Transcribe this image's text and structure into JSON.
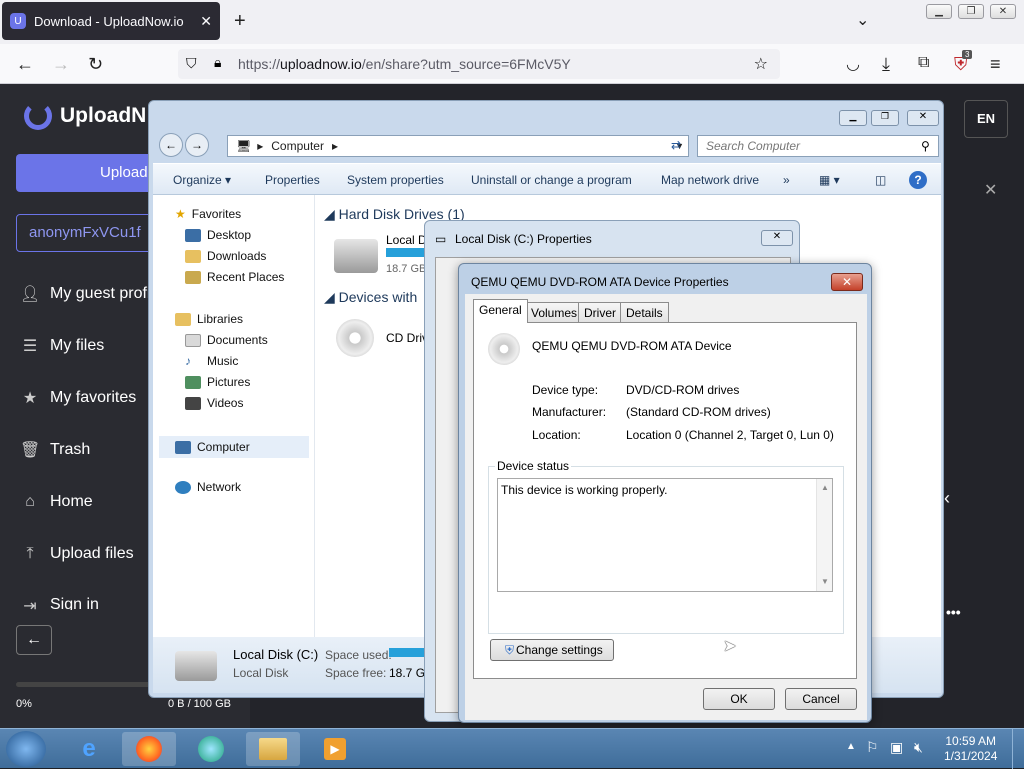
{
  "browser": {
    "tab_title": "Download - UploadNow.io",
    "url_prefix": "https://",
    "url_host": "uploadnow.io",
    "url_rest": "/en/share?utm_source=6FMcV5Y",
    "extension_badge": "3"
  },
  "site": {
    "logo_text": "UploadN",
    "upload_button": "Upload",
    "user_field": "anonymFxVCu1f",
    "nav": [
      {
        "icon": "user-icon",
        "label": "My guest profi"
      },
      {
        "icon": "list-icon",
        "label": "My files"
      },
      {
        "icon": "star-icon",
        "label": "My favorites"
      },
      {
        "icon": "trash-icon",
        "label": "Trash"
      },
      {
        "icon": "home-icon",
        "label": "Home"
      },
      {
        "icon": "upload-icon",
        "label": "Upload files"
      },
      {
        "icon": "signin-icon",
        "label": "Sign in"
      }
    ],
    "progress_percent": "0%",
    "quota": "0 B / 100 GB",
    "language": "EN"
  },
  "explorer": {
    "address": "Computer",
    "search_placeholder": "Search Computer",
    "toolbar": [
      "Organize",
      "Properties",
      "System properties",
      "Uninstall or change a program",
      "Map network drive"
    ],
    "nav": {
      "favorites": "Favorites",
      "favorites_items": [
        "Desktop",
        "Downloads",
        "Recent Places"
      ],
      "libraries": "Libraries",
      "libraries_items": [
        "Documents",
        "Music",
        "Pictures",
        "Videos"
      ],
      "computer": "Computer",
      "network": "Network"
    },
    "group_hdd": "Hard Disk Drives (1)",
    "group_removable": "Devices with",
    "drive_c_label": "Local D",
    "drive_c_size": "18.7 GB",
    "cd_label": "CD Driv",
    "details": {
      "name": "Local Disk (C:)",
      "type": "Local Disk",
      "space_used_label": "Space used:",
      "space_free_label": "Space free:",
      "space_free_value": "18.7 GB"
    }
  },
  "local_props": {
    "title": "Local Disk (C:) Properties"
  },
  "device_dialog": {
    "title": "QEMU QEMU DVD-ROM ATA Device Properties",
    "tabs": [
      "General",
      "Volumes",
      "Driver",
      "Details"
    ],
    "device_name": "QEMU QEMU DVD-ROM ATA Device",
    "device_type_label": "Device type:",
    "device_type": "DVD/CD-ROM drives",
    "manufacturer_label": "Manufacturer:",
    "manufacturer": "(Standard CD-ROM drives)",
    "location_label": "Location:",
    "location": "Location 0 (Channel 2, Target 0, Lun 0)",
    "status_legend": "Device status",
    "status_text": "This device is working properly.",
    "change_settings": "Change settings",
    "ok": "OK",
    "cancel": "Cancel"
  },
  "taskbar": {
    "time": "10:59 AM",
    "date": "1/31/2024"
  }
}
